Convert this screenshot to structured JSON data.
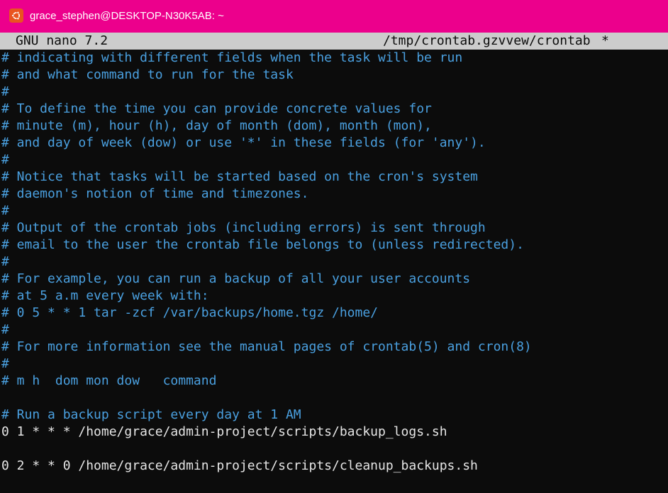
{
  "window": {
    "title": "grace_stephen@DESKTOP-N30K5AB: ~",
    "accent_color": "#ec008c",
    "icon": "ubuntu-icon"
  },
  "nano_header": {
    "version": "GNU nano 7.2",
    "file_path": "/tmp/crontab.gzvvew/crontab",
    "modified_marker": "*"
  },
  "editor": {
    "comment_color": "#4aa0e0",
    "text_color": "#e6e6e6",
    "lines": [
      {
        "text": "# indicating with different fields when the task will be run",
        "type": "comment"
      },
      {
        "text": "# and what command to run for the task",
        "type": "comment"
      },
      {
        "text": "#",
        "type": "comment"
      },
      {
        "text": "# To define the time you can provide concrete values for",
        "type": "comment"
      },
      {
        "text": "# minute (m), hour (h), day of month (dom), month (mon),",
        "type": "comment"
      },
      {
        "text": "# and day of week (dow) or use '*' in these fields (for 'any').",
        "type": "comment"
      },
      {
        "text": "#",
        "type": "comment"
      },
      {
        "text": "# Notice that tasks will be started based on the cron's system",
        "type": "comment"
      },
      {
        "text": "# daemon's notion of time and timezones.",
        "type": "comment"
      },
      {
        "text": "#",
        "type": "comment"
      },
      {
        "text": "# Output of the crontab jobs (including errors) is sent through",
        "type": "comment"
      },
      {
        "text": "# email to the user the crontab file belongs to (unless redirected).",
        "type": "comment"
      },
      {
        "text": "#",
        "type": "comment"
      },
      {
        "text": "# For example, you can run a backup of all your user accounts",
        "type": "comment"
      },
      {
        "text": "# at 5 a.m every week with:",
        "type": "comment"
      },
      {
        "text": "# 0 5 * * 1 tar -zcf /var/backups/home.tgz /home/",
        "type": "comment"
      },
      {
        "text": "#",
        "type": "comment"
      },
      {
        "text": "# For more information see the manual pages of crontab(5) and cron(8)",
        "type": "comment"
      },
      {
        "text": "#",
        "type": "comment"
      },
      {
        "text": "# m h  dom mon dow   command",
        "type": "comment"
      },
      {
        "text": "",
        "type": "blank"
      },
      {
        "text": "# Run a backup script every day at 1 AM",
        "type": "comment"
      },
      {
        "text": "0 1 * * * /home/grace/admin-project/scripts/backup_logs.sh",
        "type": "code"
      },
      {
        "text": "",
        "type": "blank"
      },
      {
        "text": "0 2 * * 0 /home/grace/admin-project/scripts/cleanup_backups.sh",
        "type": "code"
      }
    ]
  }
}
